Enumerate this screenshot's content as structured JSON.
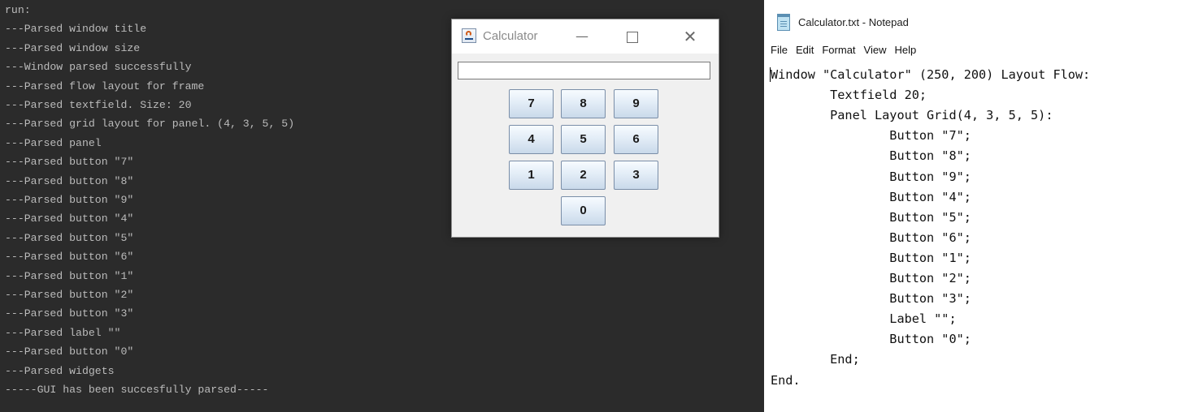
{
  "console": {
    "lines": [
      "run:",
      "---Parsed window title",
      "---Parsed window size",
      "---Window parsed successfully",
      "---Parsed flow layout for frame",
      "---Parsed textfield. Size: 20",
      "---Parsed grid layout for panel. (4, 3, 5, 5)",
      "---Parsed panel",
      "---Parsed button \"7\"",
      "---Parsed button \"8\"",
      "---Parsed button \"9\"",
      "---Parsed button \"4\"",
      "---Parsed button \"5\"",
      "---Parsed button \"6\"",
      "---Parsed button \"1\"",
      "---Parsed button \"2\"",
      "---Parsed button \"3\"",
      "---Parsed label \"\"",
      "---Parsed button \"0\"",
      "---Parsed widgets",
      "-----GUI has been succesfully parsed-----"
    ],
    "text_color": "#bbbbbb",
    "background": "#2b2b2b"
  },
  "calculator": {
    "title": "Calculator",
    "icon": "java-icon",
    "controls": {
      "minimize": "—",
      "close": "✕"
    },
    "buttons": [
      "7",
      "8",
      "9",
      "4",
      "5",
      "6",
      "1",
      "2",
      "3",
      "0"
    ]
  },
  "notepad": {
    "title": "Calculator.txt - Notepad",
    "icon": "notepad-icon",
    "menu": [
      "File",
      "Edit",
      "Format",
      "View",
      "Help"
    ],
    "lines": [
      "Window \"Calculator\" (250, 200) Layout Flow:",
      "        Textfield 20;",
      "        Panel Layout Grid(4, 3, 5, 5):",
      "                Button \"7\";",
      "                Button \"8\";",
      "                Button \"9\";",
      "                Button \"4\";",
      "                Button \"5\";",
      "                Button \"6\";",
      "                Button \"1\";",
      "                Button \"2\";",
      "                Button \"3\";",
      "                Label \"\";",
      "                Button \"0\";",
      "        End;",
      "End."
    ]
  }
}
